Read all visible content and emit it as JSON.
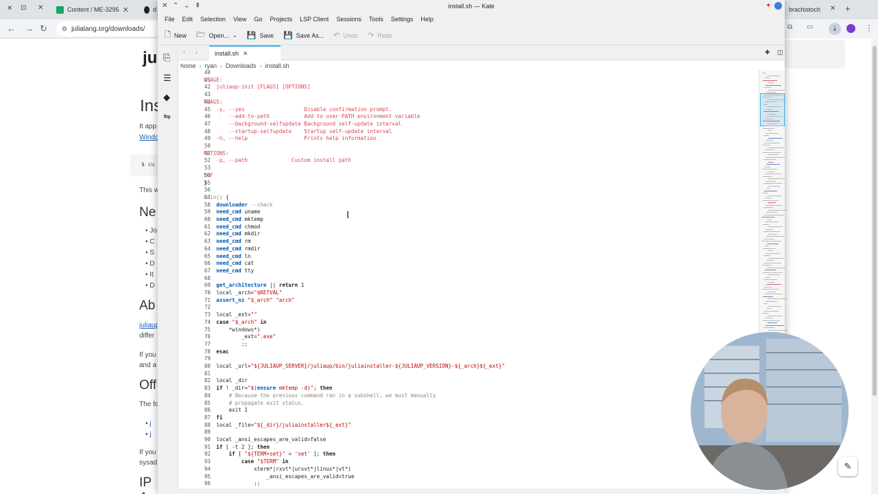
{
  "browser": {
    "tabs": [
      {
        "label": "Content / ME-3295",
        "icon": "favicon-icon"
      },
      {
        "label": "d",
        "icon": "github-icon"
      },
      {
        "label": "brachistoch",
        "icon": "favicon-icon"
      }
    ],
    "url": "julialang.org/downloads/",
    "page": {
      "heading1": "Ins",
      "text1": "It app",
      "link1": "Windo",
      "code1": "$ cu",
      "text2": "This w",
      "heading2": "Ne",
      "bullets": [
        "Jo",
        "C",
        "S",
        "D",
        "It",
        "D"
      ],
      "heading3": "Ab",
      "link2": "juliaup",
      "text3": "differ",
      "text4": "If you",
      "text5": "and a",
      "heading4": "Off",
      "text6": "The fo",
      "bullets2": [
        "j",
        "j"
      ],
      "text7": "If you",
      "text8": "sysad",
      "heading5": "IP A",
      "logo": "ju"
    }
  },
  "kate": {
    "title": "install.sh — Kate",
    "menu": [
      "File",
      "Edit",
      "Selection",
      "View",
      "Go",
      "Projects",
      "LSP Client",
      "Sessions",
      "Tools",
      "Settings",
      "Help"
    ],
    "toolbar": {
      "new": "New",
      "open": "Open...",
      "save": "Save",
      "save_as": "Save As...",
      "undo": "Undo",
      "redo": "Redo"
    },
    "tab_label": "install.sh",
    "breadcrumb": [
      "home",
      "ryan",
      "Downloads",
      "install.sh"
    ]
  },
  "code_lines": [
    {
      "n": "40",
      "t": ""
    },
    {
      "n": "41",
      "t": "USAGE:"
    },
    {
      "n": "42",
      "t": "    juliaup-init [FLAGS] [OPTIONS]"
    },
    {
      "n": "43",
      "t": ""
    },
    {
      "n": "44",
      "t": "FLAGS:"
    },
    {
      "n": "45",
      "t": "    -y, --yes                   Disable confirmation prompt."
    },
    {
      "n": "46",
      "t": "        --add-to-path           Add to user PATH environment variable"
    },
    {
      "n": "47",
      "t": "        --background-selfupdate Background self-update interval"
    },
    {
      "n": "48",
      "t": "        --startup-selfupdate    Startup self-update interval"
    },
    {
      "n": "49",
      "t": "    -h, --help                  Prints help information"
    },
    {
      "n": "50",
      "t": ""
    },
    {
      "n": "51",
      "t": "OPTIONS:"
    },
    {
      "n": "52",
      "t": "    -p, --path              Custom install path"
    },
    {
      "n": "53",
      "t": ""
    },
    {
      "n": "54",
      "t": "EOF"
    },
    {
      "n": "55",
      "t": "}"
    },
    {
      "n": "56",
      "t": ""
    },
    {
      "n": "57",
      "t": "main() {"
    },
    {
      "n": "58",
      "t": "    downloader --check"
    },
    {
      "n": "59",
      "t": "    need_cmd uname"
    },
    {
      "n": "60",
      "t": "    need_cmd mktemp"
    },
    {
      "n": "61",
      "t": "    need_cmd chmod"
    },
    {
      "n": "62",
      "t": "    need_cmd mkdir"
    },
    {
      "n": "63",
      "t": "    need_cmd rm"
    },
    {
      "n": "64",
      "t": "    need_cmd rmdir"
    },
    {
      "n": "65",
      "t": "    need_cmd ln"
    },
    {
      "n": "66",
      "t": "    need_cmd cat"
    },
    {
      "n": "67",
      "t": "    need_cmd tty"
    },
    {
      "n": "68",
      "t": ""
    },
    {
      "n": "69",
      "t": "    get_architecture || return 1"
    },
    {
      "n": "70",
      "t": "    local _arch=\"$RETVAL\""
    },
    {
      "n": "71",
      "t": "    assert_nz \"$_arch\" \"arch\""
    },
    {
      "n": "72",
      "t": ""
    },
    {
      "n": "73",
      "t": "    local _ext=\"\""
    },
    {
      "n": "74",
      "t": "    case \"$_arch\" in"
    },
    {
      "n": "75",
      "t": "        *windows*)"
    },
    {
      "n": "76",
      "t": "            _ext=\".exe\""
    },
    {
      "n": "77",
      "t": "            ;;"
    },
    {
      "n": "78",
      "t": "    esac"
    },
    {
      "n": "79",
      "t": ""
    },
    {
      "n": "80",
      "t": "    local _url=\"${JULIAUP_SERVER}/juliaup/bin/juliainstaller-${JULIAUP_VERSION}-${_arch}${_ext}\""
    },
    {
      "n": "81",
      "t": ""
    },
    {
      "n": "82",
      "t": "    local _dir"
    },
    {
      "n": "83",
      "t": "    if ! _dir=\"$(ensure mktemp -d)\"; then"
    },
    {
      "n": "84",
      "t": "        # Because the previous command ran in a subshell, we must manually"
    },
    {
      "n": "85",
      "t": "        # propagate exit status."
    },
    {
      "n": "86",
      "t": "        exit 1"
    },
    {
      "n": "87",
      "t": "    fi"
    },
    {
      "n": "88",
      "t": "    local _file=\"${_dir}/juliainstaller${_ext}\""
    },
    {
      "n": "89",
      "t": ""
    },
    {
      "n": "90",
      "t": "    local _ansi_escapes_are_valid=false"
    },
    {
      "n": "91",
      "t": "    if [ -t 2 ]; then"
    },
    {
      "n": "92",
      "t": "        if [ \"${TERM+set}\" = 'set' ]; then"
    },
    {
      "n": "93",
      "t": "            case \"$TERM\" in"
    },
    {
      "n": "94",
      "t": "                xterm*|rxvt*|urxvt*|linux*|vt*)"
    },
    {
      "n": "95",
      "t": "                    _ansi_escapes_are_valid=true"
    },
    {
      "n": "96",
      "t": "                ;;"
    }
  ],
  "colors": {
    "accent": "#3daee9",
    "usage_text": "#da4453",
    "function": "#0057ae",
    "string": "#bf0303",
    "comment": "#898887"
  }
}
